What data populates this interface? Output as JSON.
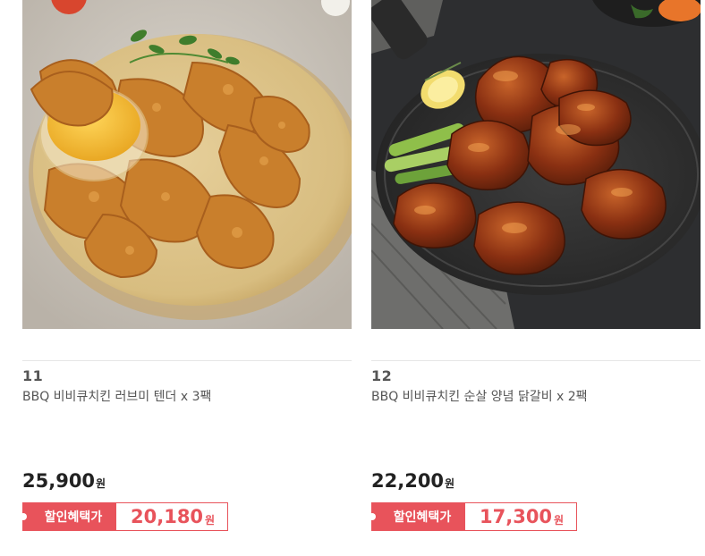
{
  "products": [
    {
      "index": "11",
      "name": "BBQ 비비큐치킨 러브미 텐더 x 3팩",
      "price": "25,900",
      "currency": "원",
      "sale_label": "할인혜택가",
      "sale_price": "20,180",
      "image_alt": "fried chicken tenders with honey mustard dip"
    },
    {
      "index": "12",
      "name": "BBQ 비비큐치킨 순살 양념 닭갈비 x 2팩",
      "price": "22,200",
      "currency": "원",
      "sale_label": "할인혜택가",
      "sale_price": "17,300",
      "image_alt": "glazed boneless chicken galbi on cast iron pan"
    }
  ],
  "colors": {
    "accent": "#e8535b",
    "price_text": "#222222",
    "divider": "#e6e6e6"
  }
}
